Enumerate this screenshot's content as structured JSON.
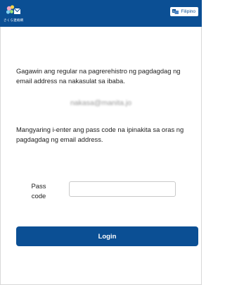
{
  "header": {
    "logo_text": "さくら連絡網",
    "language_label": "Filipino"
  },
  "main": {
    "instruction_1": "Gagawin ang regular na pagrerehistro ng pagdagdag ng email address na nakasulat sa ibaba.",
    "email": "nakasa@manita.jo",
    "instruction_2": "Mangyaring i-enter ang pass code na ipinakita sa oras ng pagdagdag ng email address.",
    "pass_code_label": "Pass code",
    "pass_code_value": "",
    "login_label": "Login"
  },
  "colors": {
    "header": "#0b4f94",
    "button": "#0b4f94"
  }
}
